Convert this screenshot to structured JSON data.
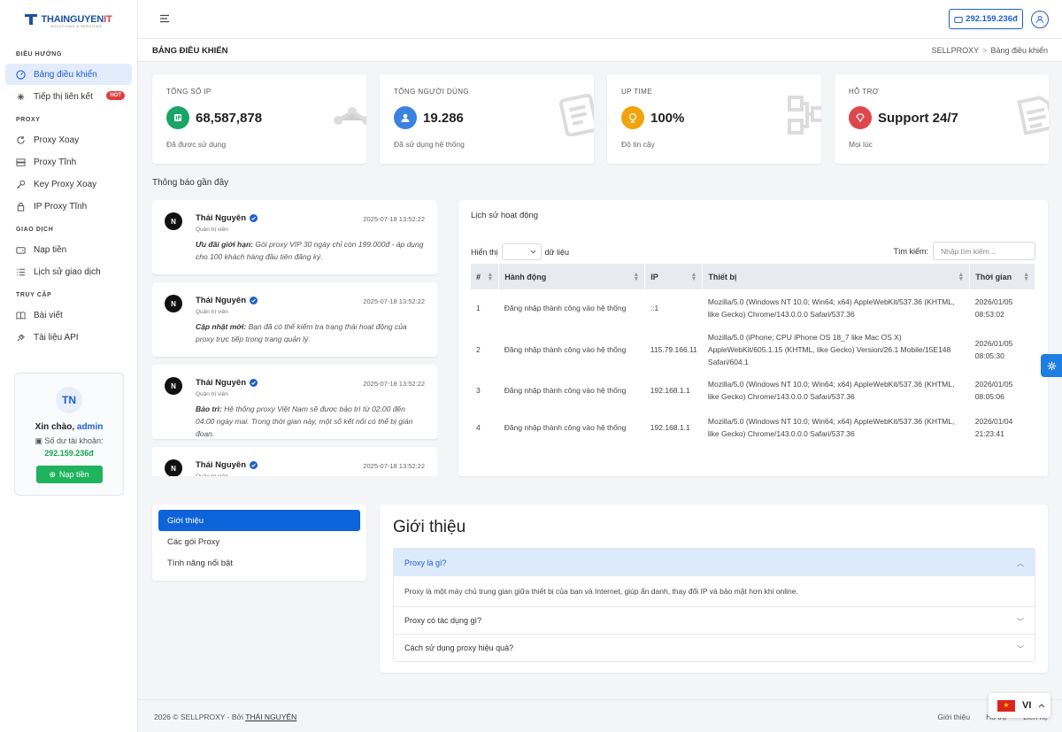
{
  "brand": {
    "logo_text": "THAINGUYEN",
    "logo_accent": "IT",
    "logo_sub": "SOLUTIONS & SERVICES"
  },
  "sidebar": {
    "sections": [
      {
        "title": "ĐIỀU HƯỚNG"
      },
      {
        "title": "PROXY"
      },
      {
        "title": "GIAO DỊCH"
      },
      {
        "title": "TRUY CẬP"
      }
    ],
    "items": [
      {
        "label": "Bảng điều khiển"
      },
      {
        "label": "Tiếp thị liên kết",
        "badge": "HOT"
      },
      {
        "label": "Proxy Xoay"
      },
      {
        "label": "Proxy Tĩnh"
      },
      {
        "label": "Key Proxy Xoay"
      },
      {
        "label": "IP Proxy Tĩnh"
      },
      {
        "label": "Nạp tiền"
      },
      {
        "label": "Lịch sử giao dịch"
      },
      {
        "label": "Bài viết"
      },
      {
        "label": "Tài liệu API"
      }
    ],
    "user_card": {
      "avatar": "TN",
      "hello": "Xin chào,",
      "username": "admin",
      "balance_label": "Số dư tài khoản:",
      "balance": "292.159.236đ",
      "button": "Nạp tiền"
    }
  },
  "topbar": {
    "balance": "292.159.236đ"
  },
  "breadcrumb": {
    "page_title": "BẢNG ĐIỀU KHIỂN",
    "root": "SELLPROXY",
    "sep": ">",
    "current": "Bảng điều khiển"
  },
  "stats": [
    {
      "label": "TỔNG SỐ IP",
      "value": "68,587,878",
      "sub": "Đã được sử dụng",
      "color": "#1aa566"
    },
    {
      "label": "TỔNG NGƯỜI DÙNG",
      "value": "19.286",
      "sub": "Đã sử dụng hệ thống",
      "color": "#3b82e0"
    },
    {
      "label": "UP TIME",
      "value": "100%",
      "sub": "Độ tin cậy",
      "color": "#f0a30a"
    },
    {
      "label": "HỖ TRỢ",
      "value": "Support 24/7",
      "sub": "Mọi lúc",
      "color": "#e0474c"
    }
  ],
  "notices_title": "Thông báo gần đây",
  "notices": [
    {
      "name": "Thái Nguyên",
      "role": "Quản trị viên",
      "time": "2025-07-18 13:52:22",
      "tag": "Ưu đãi giới hạn:",
      "text": "Gói proxy VIP 30 ngày chỉ còn 199.000đ - áp dụng cho 100 khách hàng đầu tiên đăng ký."
    },
    {
      "name": "Thái Nguyên",
      "role": "Quản trị viên",
      "time": "2025-07-18 13:52:22",
      "tag": "Cập nhật mới:",
      "text": "Bạn đã có thể kiểm tra trạng thái hoạt động của proxy trực tiếp trong trang quản lý."
    },
    {
      "name": "Thái Nguyên",
      "role": "Quản trị viên",
      "time": "2025-07-18 13:52:22",
      "tag": "Bảo trì:",
      "text": "Hệ thống proxy Việt Nam sẽ được bảo trì từ 02:00 đến 04:00 ngày mai. Trong thời gian này, một số kết nối có thể bị gián đoạn."
    },
    {
      "name": "Thái Nguyên",
      "role": "Quản trị viên",
      "time": "2025-07-18 13:52:22",
      "tag": "",
      "text": ""
    }
  ],
  "history": {
    "title": "Lịch sử hoạt động",
    "show_label": "Hiển thị",
    "show_suffix": "dữ liệu",
    "search_label": "Tìm kiếm:",
    "search_placeholder": "Nhập tìm kiếm...",
    "columns": [
      "#",
      "Hành động",
      "IP",
      "Thiết bị",
      "Thời gian"
    ],
    "rows": [
      {
        "n": "1",
        "action": "Đăng nhập thành công vào hệ thống",
        "ip": "::1",
        "device": "Mozilla/5.0 (Windows NT 10.0; Win64; x64) AppleWebKit/537.36 (KHTML, like Gecko) Chrome/143.0.0.0 Safari/537.36",
        "date": "2026/01/05",
        "time": "08:53:02"
      },
      {
        "n": "2",
        "action": "Đăng nhập thành công vào hệ thống",
        "ip": "115.79.166.11",
        "device": "Mozilla/5.0 (iPhone; CPU iPhone OS 18_7 like Mac OS X) AppleWebKit/605.1.15 (KHTML, like Gecko) Version/26.1 Mobile/15E148 Safari/604.1",
        "date": "2026/01/05",
        "time": "08:05:30"
      },
      {
        "n": "3",
        "action": "Đăng nhập thành công vào hệ thống",
        "ip": "192.168.1.1",
        "device": "Mozilla/5.0 (Windows NT 10.0; Win64; x64) AppleWebKit/537.36 (KHTML, like Gecko) Chrome/143.0.0.0 Safari/537.36",
        "date": "2026/01/05",
        "time": "08:05:06"
      },
      {
        "n": "4",
        "action": "Đăng nhập thành công vào hệ thống",
        "ip": "192.168.1.1",
        "device": "Mozilla/5.0 (Windows NT 10.0; Win64; x64) AppleWebKit/537.36 (KHTML, like Gecko) Chrome/143.0.0.0 Safari/537.36",
        "date": "2026/01/04",
        "time": "21:23:41"
      }
    ]
  },
  "intro": {
    "tabs": [
      "Giới thiệu",
      "Các gói Proxy",
      "Tính năng nổi bật"
    ],
    "heading": "Giới thiệu",
    "faq": [
      {
        "q": "Proxy là gì?",
        "a": "Proxy là một máy chủ trung gian giữa thiết bị của bạn và Internet, giúp ẩn danh, thay đổi IP và bảo mật hơn khi online."
      },
      {
        "q": "Proxy có tác dụng gì?"
      },
      {
        "q": "Cách sử dụng proxy hiệu quả?"
      }
    ]
  },
  "footer": {
    "copy": "2026 © SELLPROXY - Bởi",
    "author": "THÁI NGUYÊN",
    "links": [
      "Giới thiệu",
      "Hỗ trợ",
      "Liên hệ"
    ]
  },
  "lang": {
    "code": "VI"
  }
}
